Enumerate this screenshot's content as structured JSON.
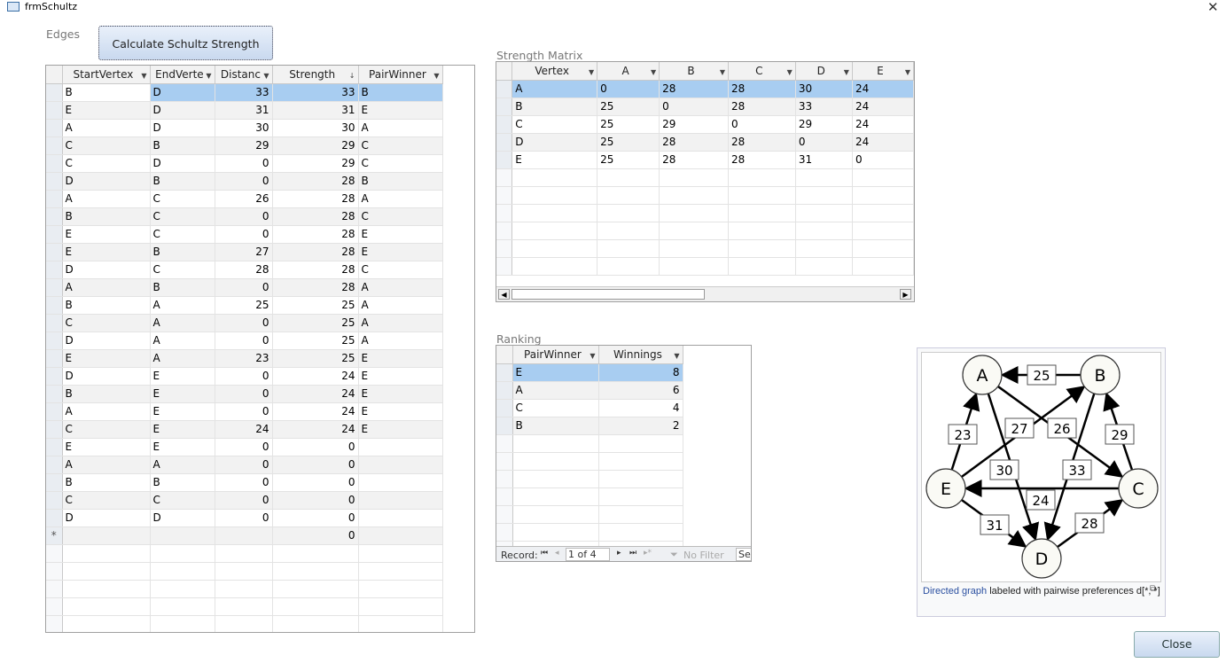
{
  "window": {
    "title": "frmSchultz",
    "close": "✕"
  },
  "edges": {
    "label": "Edges",
    "calc_button": "Calculate Schultz Strength",
    "columns": [
      "StartVertex",
      "EndVerte",
      "Distanc",
      "Strength",
      "PairWinner"
    ],
    "sort_column": "Strength",
    "rows": [
      [
        "B",
        "D",
        "33",
        "33",
        "B"
      ],
      [
        "E",
        "D",
        "31",
        "31",
        "E"
      ],
      [
        "A",
        "D",
        "30",
        "30",
        "A"
      ],
      [
        "C",
        "B",
        "29",
        "29",
        "C"
      ],
      [
        "C",
        "D",
        "0",
        "29",
        "C"
      ],
      [
        "D",
        "B",
        "0",
        "28",
        "B"
      ],
      [
        "A",
        "C",
        "26",
        "28",
        "A"
      ],
      [
        "B",
        "C",
        "0",
        "28",
        "C"
      ],
      [
        "E",
        "C",
        "0",
        "28",
        "E"
      ],
      [
        "E",
        "B",
        "27",
        "28",
        "E"
      ],
      [
        "D",
        "C",
        "28",
        "28",
        "C"
      ],
      [
        "A",
        "B",
        "0",
        "28",
        "A"
      ],
      [
        "B",
        "A",
        "25",
        "25",
        "A"
      ],
      [
        "C",
        "A",
        "0",
        "25",
        "A"
      ],
      [
        "D",
        "A",
        "0",
        "25",
        "A"
      ],
      [
        "E",
        "A",
        "23",
        "25",
        "E"
      ],
      [
        "D",
        "E",
        "0",
        "24",
        "E"
      ],
      [
        "B",
        "E",
        "0",
        "24",
        "E"
      ],
      [
        "A",
        "E",
        "0",
        "24",
        "E"
      ],
      [
        "C",
        "E",
        "24",
        "24",
        "E"
      ],
      [
        "E",
        "E",
        "0",
        "0",
        ""
      ],
      [
        "A",
        "A",
        "0",
        "0",
        ""
      ],
      [
        "B",
        "B",
        "0",
        "0",
        ""
      ],
      [
        "C",
        "C",
        "0",
        "0",
        ""
      ],
      [
        "D",
        "D",
        "0",
        "0",
        ""
      ]
    ],
    "new_row": {
      "marker": "*",
      "strength": "0"
    }
  },
  "matrix": {
    "label": "Strength Matrix",
    "columns": [
      "Vertex",
      "A",
      "B",
      "C",
      "D",
      "E"
    ],
    "rows": [
      [
        "A",
        "0",
        "28",
        "28",
        "30",
        "24"
      ],
      [
        "B",
        "25",
        "0",
        "28",
        "33",
        "24"
      ],
      [
        "C",
        "25",
        "29",
        "0",
        "29",
        "24"
      ],
      [
        "D",
        "25",
        "28",
        "28",
        "0",
        "24"
      ],
      [
        "E",
        "25",
        "28",
        "28",
        "31",
        "0"
      ]
    ]
  },
  "ranking": {
    "label": "Ranking",
    "columns": [
      "PairWinner",
      "Winnings"
    ],
    "rows": [
      [
        "E",
        "8"
      ],
      [
        "A",
        "6"
      ],
      [
        "C",
        "4"
      ],
      [
        "B",
        "2"
      ]
    ],
    "nav": {
      "record_label": "Record:",
      "position": "1 of 4",
      "filter": "No Filter",
      "search": "Se"
    }
  },
  "graph": {
    "nodes": [
      "A",
      "B",
      "C",
      "D",
      "E"
    ],
    "edges": [
      {
        "from": "B",
        "to": "A",
        "label": "25"
      },
      {
        "from": "E",
        "to": "A",
        "label": "23"
      },
      {
        "from": "E",
        "to": "B",
        "label": "27"
      },
      {
        "from": "A",
        "to": "C",
        "label": "26"
      },
      {
        "from": "C",
        "to": "B",
        "label": "29"
      },
      {
        "from": "A",
        "to": "D",
        "label": "30"
      },
      {
        "from": "B",
        "to": "D",
        "label": "33"
      },
      {
        "from": "C",
        "to": "E",
        "label": "24"
      },
      {
        "from": "E",
        "to": "D",
        "label": "31"
      },
      {
        "from": "D",
        "to": "C",
        "label": "28"
      }
    ],
    "caption_link": "Directed graph",
    "caption_text": " labeled with pairwise preferences d[*, *]"
  },
  "close_button": "Close"
}
